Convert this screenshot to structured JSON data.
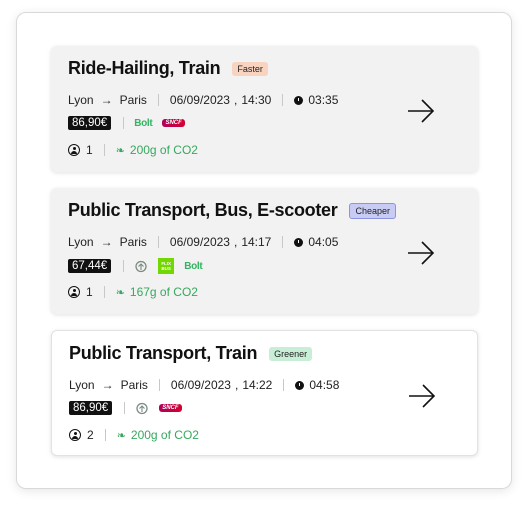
{
  "cards": [
    {
      "title": "Ride-Hailing, Train",
      "badge": "Faster",
      "from": "Lyon",
      "to": "Paris",
      "date": "06/09/2023",
      "time": "14:30",
      "duration": "03:35",
      "price": "86,90€",
      "providers": [
        "Bolt",
        "SNCF"
      ],
      "passengers": "1",
      "co2": "200g of CO2"
    },
    {
      "title": "Public Transport, Bus, E-scooter",
      "badge": "Cheaper",
      "from": "Lyon",
      "to": "Paris",
      "date": "06/09/2023",
      "time": "14:17",
      "duration": "04:05",
      "price": "67,44€",
      "providers": [
        "Transit",
        "FlixBus",
        "Bolt"
      ],
      "flix_line1": "FLIX",
      "flix_line2": "BUS",
      "passengers": "1",
      "co2": "167g of CO2"
    },
    {
      "title": "Public Transport, Train",
      "badge": "Greener",
      "from": "Lyon",
      "to": "Paris",
      "date": "06/09/2023",
      "time": "14:22",
      "duration": "04:58",
      "price": "86,90€",
      "providers": [
        "Transit",
        "SNCF"
      ],
      "passengers": "2",
      "co2": "200g of CO2"
    }
  ],
  "logos": {
    "bolt": "Bolt",
    "sncf": "SNCF"
  },
  "date_time_sep": ",",
  "colors": {
    "accent_green": "#37a85e",
    "faster": "#f8d3bf",
    "cheaper": "#c8ccf4",
    "greener": "#c9eed7"
  }
}
